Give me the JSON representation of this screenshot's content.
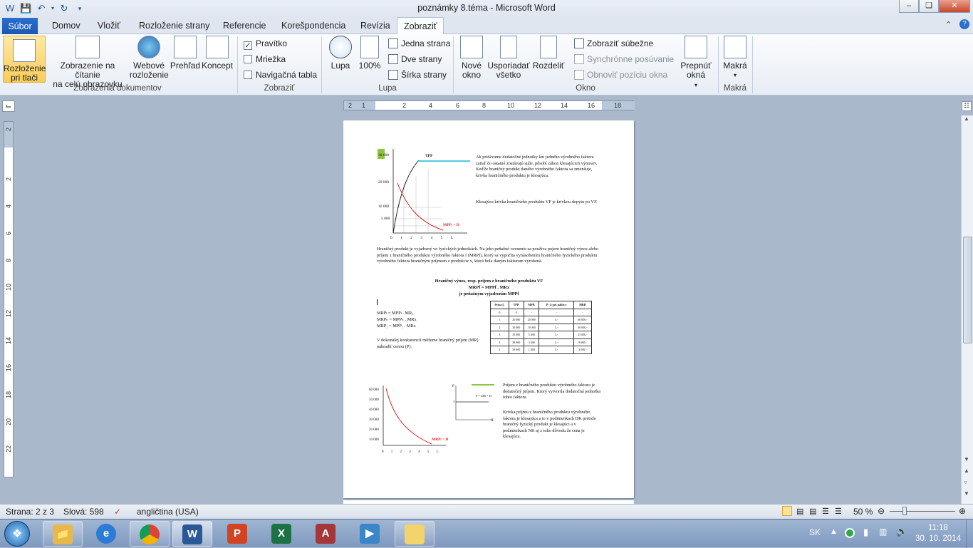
{
  "window": {
    "title": "poznámky 8.téma - Microsoft Word"
  },
  "qat": {
    "save_icon": "save-icon",
    "undo_icon": "undo-icon",
    "redo_icon": "redo-icon",
    "customize_icon": "customize-icon"
  },
  "tabs": [
    "Súbor",
    "Domov",
    "Vložiť",
    "Rozloženie strany",
    "Referencie",
    "Korešpondencia",
    "Revízia",
    "Zobraziť"
  ],
  "active_tab": "Zobraziť",
  "ribbon": {
    "views": {
      "print_layout": "Rozloženie\npri tlači",
      "full_reading": "Zobrazenie na čítanie\nna celú obrazovku",
      "web": "Webové\nrozloženie",
      "outline": "Prehľad",
      "draft": "Koncept",
      "label": "Zobrazenia dokumentov"
    },
    "show": {
      "ruler": "Pravítko",
      "gridlines": "Mriežka",
      "nav_pane": "Navigačná tabla",
      "label": "Zobraziť",
      "ruler_checked": true
    },
    "zoom": {
      "zoom": "Lupa",
      "hundred": "100%",
      "one_page": "Jedna strana",
      "two_pages": "Dve strany",
      "page_width": "Šírka strany",
      "label": "Lupa"
    },
    "window": {
      "new_window": "Nové\nokno",
      "arrange_all": "Usporiadať\nvšetko",
      "split": "Rozdeliť",
      "side_by_side": "Zobraziť súbežne",
      "sync_scroll": "Synchrónne posúvanie",
      "reset_position": "Obnoviť pozíciu okna",
      "switch_windows": "Prepnúť\nokná",
      "label": "Okno"
    },
    "macros": {
      "macros": "Makrá",
      "label": "Makrá"
    }
  },
  "ruler": {
    "ticks": [
      "2",
      "1",
      "2",
      "4",
      "6",
      "8",
      "10",
      "12",
      "14",
      "16",
      "18"
    ],
    "vticks": [
      "2",
      "2",
      "4",
      "6",
      "8",
      "10",
      "12",
      "14",
      "16",
      "18",
      "20",
      "22"
    ]
  },
  "document": {
    "chart1": {
      "y_ticks": [
        "30 000",
        "20 000",
        "10 000",
        "5 000"
      ],
      "x_ticks": [
        "0",
        "1",
        "2",
        "3",
        "4",
        "5",
        "L"
      ],
      "curve_tpp": "TPP",
      "curve_mpp": "MPPₗ = D"
    },
    "para1": "Ak pridávame dodatočné jednotky len jedného výrobného faktora zatiaľ čo ostatné zostávajú stále, pôsobí zákon klesajúcich výnosov. Keďže hraničný produkt daného výrobného faktora sa zmenšuje, krivka hraničného produktu je klesajúca.",
    "para2": "Klesajúca krivka hraničného produktu VF je krivkou dopytu po VF.",
    "para3": "Hraničný produkt je vyjadrený vo fyzických jednotkách. Na jeho peňažné ocenenie sa používa pojem hraničný výnos alebo príjem z hraničného produktu výrobného faktora f (MRPf), ktorý sa vypočíta vynásobením hraničného fyzického produktu výrobného faktora hraničným príjmom z produkcie x, ktorá bola daným faktorom vyrobená.",
    "heading1": "Hraničný výnos, resp. príjem z hraničného produktu VF",
    "heading2": "MRPf = MPPf . MRx",
    "heading3": "je peňažným vyjadrením MPPf",
    "formula1": "MRPₗ = MPPₗ . MRₓ",
    "formula2": "MRPₖ = MPPₖ . MRx",
    "formula3": "MRP₂ = MPP₂ . MRx",
    "para4": "V dokonalej konkurencii môžeme hraničný príjem (MR) nahradiť cenou (P).",
    "table": {
      "headers": [
        "Práca L",
        "TPPₗ",
        "MPPₗ",
        "P - k pol. nákla x",
        "MRPₗ"
      ],
      "rows": [
        [
          "0",
          "0",
          "-",
          "-",
          "-"
        ],
        [
          "1",
          "20 000",
          "20 000",
          "3,-",
          "60 000,-"
        ],
        [
          "2",
          "30 000",
          "10 000",
          "3,-",
          "30 000,-"
        ],
        [
          "3",
          "35 000",
          "5 000",
          "3,-",
          "15 000,-"
        ],
        [
          "4",
          "38 000",
          "3 000",
          "3,-",
          "9 000,-"
        ],
        [
          "5",
          "39 000",
          "1 000",
          "3,-",
          "3 000,-"
        ]
      ]
    },
    "chart2": {
      "y_ticks": [
        "60 000",
        "50 000",
        "40 000",
        "30 000",
        "20 000",
        "10 000"
      ],
      "x_ticks": [
        "0",
        "1",
        "2",
        "3",
        "4",
        "5",
        "L"
      ],
      "curve": "MRPₗ = D"
    },
    "chart3": {
      "p_label": "P",
      "line": "P = MR = D",
      "x_label": "X",
      "y_mark": "3"
    },
    "para5": "Príjem z hraničného produktu výrobného faktora je dodatočný príjem. Ktorý vytvorila dodatočná jednotka tohto faktora.",
    "para6": "Krivka príjmu z hraničného produktu výrobného faktora je klesajúca a to v podmienkach DK pretože hraničný fyzický produkt je klesajúci a v podmienkach NK aj z toho dôvodu že cena je klesajúca."
  },
  "status": {
    "page": "Strana: 2 z 3",
    "words": "Slová: 598",
    "language": "angličtina (USA)",
    "zoom": "50 %"
  },
  "taskbar": {
    "lang": "SK",
    "time": "11:18",
    "date": "30. 10. 2014",
    "apps": [
      "explorer-icon",
      "ie-icon",
      "chrome-icon",
      "word-icon",
      "powerpoint-icon",
      "excel-icon",
      "access-icon",
      "media-icon",
      "folder-icon"
    ]
  }
}
